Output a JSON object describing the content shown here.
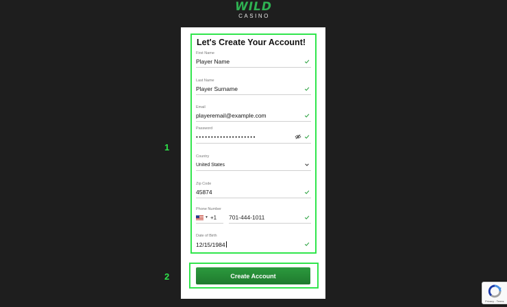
{
  "logo": {
    "brand": "WILD",
    "sub": "CASINO"
  },
  "form": {
    "title": "Let's Create Your Account!",
    "fields": [
      {
        "label": "First Name",
        "value": "Player Name"
      },
      {
        "label": "Last Name",
        "value": "Player Surname"
      },
      {
        "label": "Email",
        "value": "playeremail@example.com"
      },
      {
        "label": "Password",
        "value": "••••••••••••••••••••"
      },
      {
        "label": "Country",
        "value": "United States"
      },
      {
        "label": "Zip Code",
        "value": "45874"
      },
      {
        "label": "Phone Number",
        "code": "+1",
        "value": "701-444-1011"
      },
      {
        "label": "Date of Birth",
        "value": "12/15/1984"
      }
    ],
    "submit_label": "Create Account"
  },
  "steps": {
    "one": "1",
    "two": "2"
  },
  "recaptcha": {
    "text": "Privacy - Terms"
  },
  "colors": {
    "accent": "#2ee54a",
    "button": "#1f7a2e",
    "brand": "#2fb152"
  },
  "icons": [
    "check-icon",
    "eye-icon",
    "chevron-down-icon",
    "us-flag-icon",
    "recaptcha-icon"
  ]
}
